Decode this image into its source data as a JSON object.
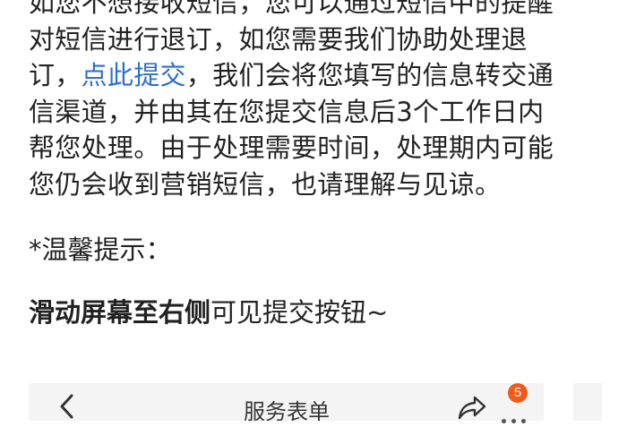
{
  "article": {
    "lines": [
      "如您不想接收短信，您可以通过短信中的提醒",
      "对短信进行退订，如您需要我们协助处理退"
    ],
    "line3_prefix": "订，",
    "link_text": "点此提交",
    "line3_suffix": "，我们会将您填写的信息转交通",
    "more_lines": [
      "信渠道，并由其在您提交信息后3个工作日内",
      "帮您处理。由于处理需要时间，处理期内可能",
      "您仍会收到营销短信，也请理解与见谅。"
    ],
    "tip": "*温馨提示：",
    "hint_bold": "滑动屏幕至右侧",
    "hint_rest": "可见提交按钮~",
    "link_color": "#2d6fd1"
  },
  "phone_header": {
    "back_icon": "chevron-left-icon",
    "title": "服务表单",
    "share_icon": "share-icon",
    "badge_count": "5",
    "more_icon": "more-dots-icon",
    "badge_color": "#f05a1a"
  }
}
